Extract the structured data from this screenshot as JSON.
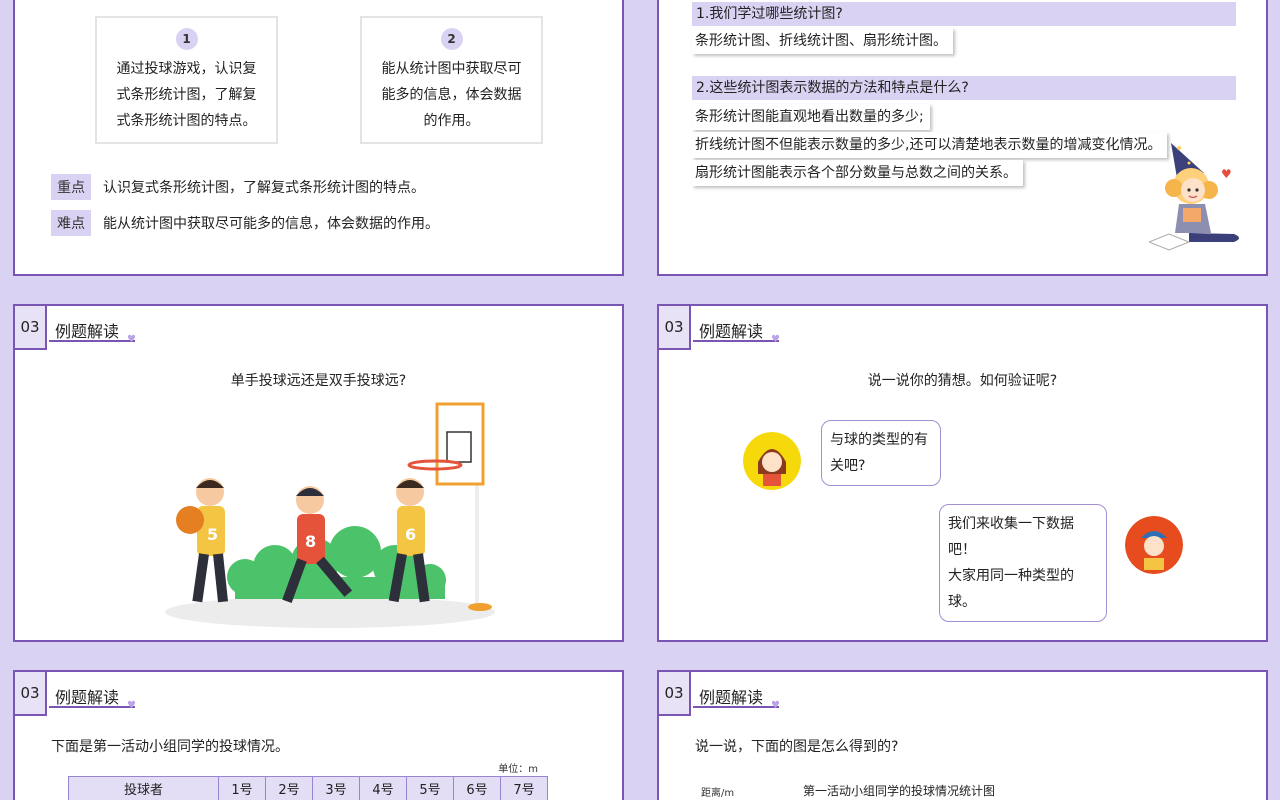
{
  "slide1": {
    "objectives": [
      {
        "num": "1",
        "lines": [
          "通过投球游戏，认识复",
          "式条形统计图，了解复",
          "式条形统计图的特点。"
        ]
      },
      {
        "num": "2",
        "lines": [
          "能从统计图中获取尽可",
          "能多的信息，体会数据",
          "的作用。"
        ]
      }
    ],
    "key_label": "重点",
    "key_text": "认识复式条形统计图，了解复式条形统计图的特点。",
    "difficulty_label": "难点",
    "difficulty_text": "能从统计图中获取尽可能多的信息，体会数据的作用。"
  },
  "slide2": {
    "q1": "1.我们学过哪些统计图?",
    "a1": "条形统计图、折线统计图、扇形统计图。",
    "q2": "2.这些统计图表示数据的方法和特点是什么?",
    "a2_1": "条形统计图能直观地看出数量的多少;",
    "a2_2": "折线统计图不但能表示数量的多少,还可以清楚地表示数量的增减变化情况。",
    "a2_3": "扇形统计图能表示各个部分数量与总数之间的关系。"
  },
  "header": {
    "num": "03",
    "title": "例题解读"
  },
  "slide3": {
    "question": "单手投球远还是双手投球远?",
    "jersey_numbers": [
      "5",
      "8",
      "6"
    ]
  },
  "slide4": {
    "question": "说一说你的猜想。如何验证呢?",
    "bubble1": [
      "与球的类型的有",
      "关吧?"
    ],
    "bubble2": [
      "我们来收集一下数据吧！",
      "大家用同一种类型的球。"
    ]
  },
  "slide5": {
    "intro": "下面是第一活动小组同学的投球情况。",
    "unit": "单位：m",
    "table_header": [
      "投球者",
      "1号",
      "2号",
      "3号",
      "4号",
      "5号",
      "6号",
      "7号"
    ]
  },
  "slide6": {
    "intro": "说一说，下面的图是怎么得到的?",
    "axis_label": "距离/m",
    "chart_title": "第一活动小组同学的投球情况统计图"
  },
  "colors": {
    "accent": "#7b55b3",
    "light": "#d9d2f2",
    "background": "#d9d2f2"
  }
}
